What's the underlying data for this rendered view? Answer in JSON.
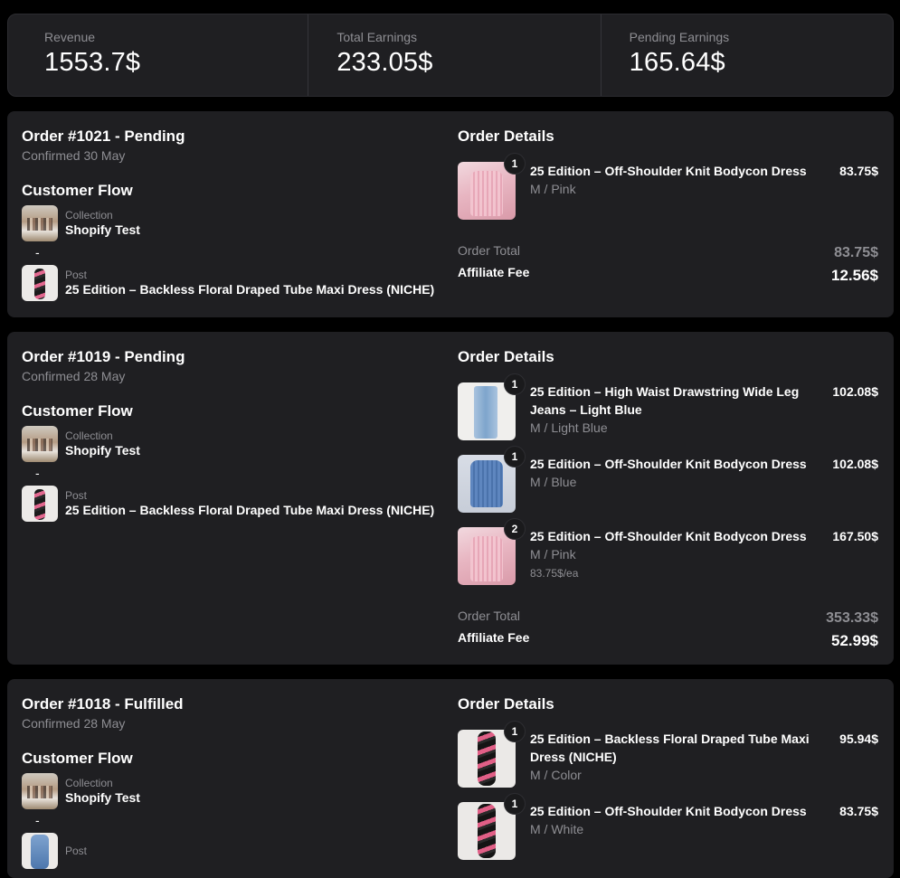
{
  "stats": [
    {
      "label": "Revenue",
      "value": "1553.7$"
    },
    {
      "label": "Total Earnings",
      "value": "233.05$"
    },
    {
      "label": "Pending Earnings",
      "value": "165.64$"
    }
  ],
  "labels": {
    "customer_flow": "Customer Flow",
    "order_details": "Order Details",
    "collection": "Collection",
    "post": "Post",
    "order_total": "Order Total",
    "affiliate_fee": "Affiliate Fee",
    "dash": "-"
  },
  "orders": [
    {
      "title": "Order #1021 - Pending",
      "confirmed": "Confirmed 30 May",
      "collection": "Shopify Test",
      "post": "25 Edition – Backless Floral Draped Tube Maxi Dress (NICHE)",
      "items": [
        {
          "qty": "1",
          "name": "25 Edition – Off-Shoulder Knit Bodycon Dress",
          "variant": "M / Pink",
          "price": "83.75$",
          "each": ""
        }
      ],
      "order_total": "83.75$",
      "affiliate_fee": "12.56$"
    },
    {
      "title": "Order #1019 - Pending",
      "confirmed": "Confirmed 28 May",
      "collection": "Shopify Test",
      "post": "25 Edition – Backless Floral Draped Tube Maxi Dress (NICHE)",
      "items": [
        {
          "qty": "1",
          "name": "25 Edition – High Waist Drawstring Wide Leg Jeans – Light Blue",
          "variant": "M / Light Blue",
          "price": "102.08$",
          "each": ""
        },
        {
          "qty": "1",
          "name": "25 Edition – Off-Shoulder Knit Bodycon Dress",
          "variant": "M / Blue",
          "price": "102.08$",
          "each": ""
        },
        {
          "qty": "2",
          "name": "25 Edition – Off-Shoulder Knit Bodycon Dress",
          "variant": "M / Pink",
          "price": "167.50$",
          "each": "83.75$/ea"
        }
      ],
      "order_total": "353.33$",
      "affiliate_fee": "52.99$"
    },
    {
      "title": "Order #1018 - Fulfilled",
      "confirmed": "Confirmed 28 May",
      "collection": "Shopify Test",
      "post": "",
      "items": [
        {
          "qty": "1",
          "name": "25 Edition – Backless Floral Draped Tube Maxi Dress (NICHE)",
          "variant": "M / Color",
          "price": "95.94$",
          "each": ""
        },
        {
          "qty": "1",
          "name": "25 Edition – Off-Shoulder Knit Bodycon Dress",
          "variant": "M / White",
          "price": "83.75$",
          "each": ""
        }
      ]
    }
  ]
}
